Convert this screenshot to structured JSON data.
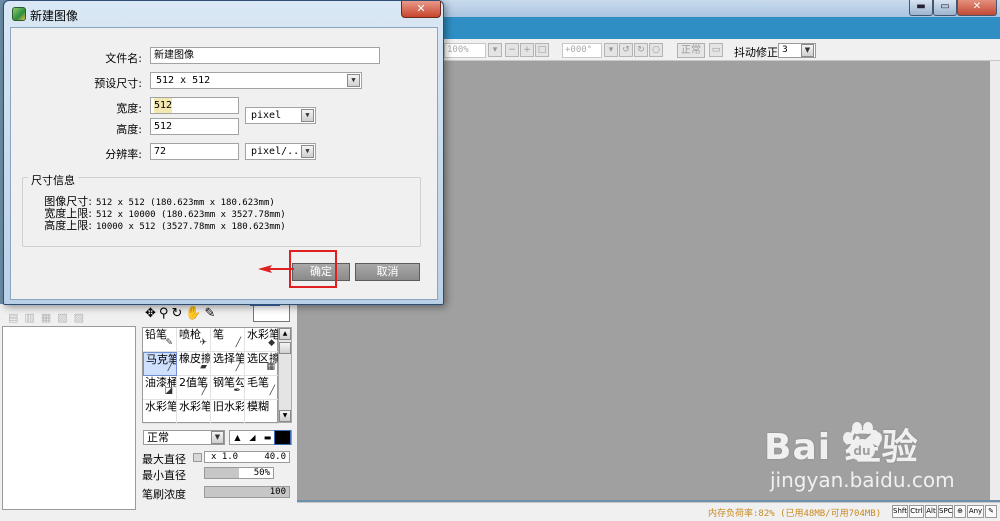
{
  "dialog": {
    "title": "新建图像",
    "filename_label": "文件名:",
    "filename_value": "新建图像",
    "preset_label": "预设尺寸:",
    "preset_value": "512 x  512",
    "width_label": "宽度:",
    "width_value": "512",
    "height_label": "高度:",
    "height_value": "512",
    "unit_value": "pixel",
    "resolution_label": "分辨率:",
    "resolution_value": "72",
    "res_unit_value": "pixel/...",
    "info_title": "尺寸信息",
    "info": [
      {
        "label": "图像尺寸:",
        "value": "512 x 512  (180.623mm x 180.623mm)"
      },
      {
        "label": "宽度上限:",
        "value": "512 x 10000  (180.623mm x 3527.78mm)"
      },
      {
        "label": "高度上限:",
        "value": "10000 x 512  (3527.78mm x 180.623mm)"
      }
    ],
    "ok_label": "确定",
    "cancel_label": "取消",
    "close_glyph": "✕"
  },
  "window_controls": {
    "min": "▬",
    "max": "▭",
    "close": "✕"
  },
  "toolbar": {
    "zoom_value": "100%",
    "rotate_value": "+000°",
    "mode_label": "正常",
    "stabilizer_label": "抖动修正",
    "stabilizer_value": "3"
  },
  "brushes": [
    {
      "name": "铅笔",
      "icon": "pencil-icon",
      "glyph": "✎"
    },
    {
      "name": "喷枪",
      "icon": "airbrush-icon",
      "glyph": "✈"
    },
    {
      "name": "笔",
      "icon": "pen-icon",
      "glyph": "╱"
    },
    {
      "name": "水彩笔",
      "icon": "watercolor-icon",
      "glyph": "💧"
    },
    {
      "name": "马克笔",
      "icon": "marker-icon",
      "glyph": "╱",
      "selected": true
    },
    {
      "name": "橡皮擦",
      "icon": "eraser-icon",
      "glyph": "▰"
    },
    {
      "name": "选择笔",
      "icon": "select-pen-icon",
      "glyph": "╱"
    },
    {
      "name": "选区擦",
      "icon": "select-eraser-icon",
      "glyph": "▦"
    },
    {
      "name": "油漆桶",
      "icon": "bucket-icon",
      "glyph": "◪"
    },
    {
      "name": "2值笔",
      "icon": "binary-pen-icon",
      "glyph": "╱"
    },
    {
      "name": "钢笔勾",
      "icon": "ink-pen-icon",
      "glyph": "✒"
    },
    {
      "name": "毛笔",
      "icon": "brush-icon",
      "glyph": "╱"
    },
    {
      "name": "水彩笔",
      "icon": "watercolor2-icon",
      "glyph": ""
    },
    {
      "name": "水彩笔",
      "icon": "watercolor3-icon",
      "glyph": ""
    },
    {
      "name": "旧水彩",
      "icon": "old-watercolor-icon",
      "glyph": ""
    },
    {
      "name": "模糊",
      "icon": "blur-icon",
      "glyph": ""
    }
  ],
  "brush_params": {
    "mode_value": "正常",
    "max_size_label": "最大直径",
    "max_size_multiplier": "x 1.0",
    "max_size_value": "40.0",
    "min_size_label": "最小直径",
    "min_size_value": "50%",
    "min_size_fraction": 0.5,
    "density_label": "笔刷浓度",
    "density_value": "100",
    "density_fraction": 1.0
  },
  "status": {
    "memory_text": "内存负荷率:82% (已用48MB/可用704MB)",
    "keys": [
      "Shft",
      "Ctrl",
      "Alt",
      "SPC",
      "⊕",
      "Any",
      "✎"
    ]
  },
  "watermark": {
    "brand": "Bai  经验",
    "url": "jingyan.baidu.com"
  },
  "colors": {
    "annotation": "#e02020",
    "accent": "#2f8fc4"
  }
}
